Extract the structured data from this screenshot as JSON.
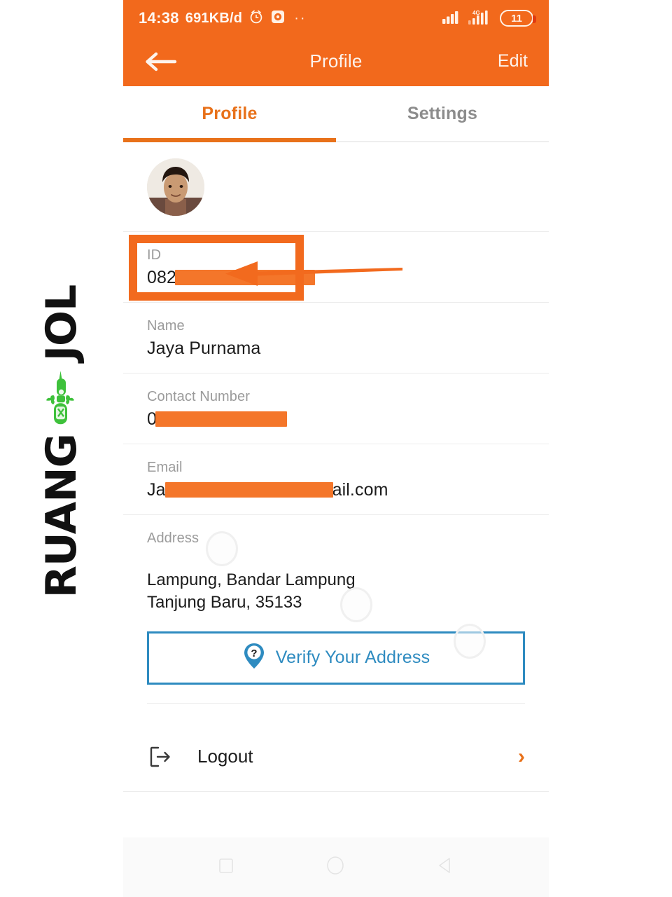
{
  "status_bar": {
    "time": "14:38",
    "data_rate": "691KB/d",
    "alarm_icon": "alarm-clock-icon",
    "recorder_icon": "screen-recorder-icon",
    "more_dots": "··",
    "signal_icon_1": "signal-bars-icon",
    "network_label": "4G",
    "signal_icon_2": "signal-bars-4g-icon",
    "battery_level": "11",
    "background_color": "#F2691C"
  },
  "app_bar": {
    "back_icon": "back-arrow-icon",
    "title": "Profile",
    "edit_label": "Edit",
    "background_color": "#F2691C"
  },
  "tabs": {
    "active_index": 0,
    "accent_color": "#E8711A",
    "items": [
      {
        "label": "Profile"
      },
      {
        "label": "Settings"
      }
    ]
  },
  "profile": {
    "avatar_alt": "user-avatar",
    "fields": [
      {
        "key": "id",
        "label": "ID",
        "value_prefix": "082",
        "value_suffix": "",
        "redacted": true
      },
      {
        "key": "name",
        "label": "Name",
        "value_prefix": "Jaya Purnama",
        "value_suffix": "",
        "redacted": false
      },
      {
        "key": "phone",
        "label": "Contact Number",
        "value_prefix": "0",
        "value_suffix": "",
        "redacted": true
      },
      {
        "key": "email",
        "label": "Email",
        "value_prefix": "Ja",
        "value_suffix": "ail.com",
        "redacted": true
      }
    ],
    "address": {
      "label": "Address",
      "line1": "Lampung, Bandar Lampung",
      "line2": "Tanjung Baru, 35133",
      "verify_button": {
        "label": "Verify Your Address",
        "icon": "location-pin-question-icon",
        "color": "#2E8BC0"
      }
    },
    "logout": {
      "label": "Logout",
      "icon": "logout-icon",
      "chevron": "›",
      "chevron_color": "#E8711A"
    }
  },
  "annotations": {
    "id_highlight_box": {
      "color": "#F26A1E",
      "target": "ID field"
    },
    "pointer_arrow": {
      "color": "#F26A1E",
      "direction": "left",
      "target": "ID field"
    },
    "redaction_color": "#F4762A"
  },
  "watermark": {
    "text_top": "JOL",
    "text_bottom": "RUANG",
    "icon": "green-motorbike-icon",
    "icon_color": "#3EC13B",
    "text_color": "#111111"
  },
  "system_nav": {
    "recents_icon": "square-recents-icon",
    "home_icon": "circle-home-icon",
    "back_icon": "triangle-back-icon"
  }
}
